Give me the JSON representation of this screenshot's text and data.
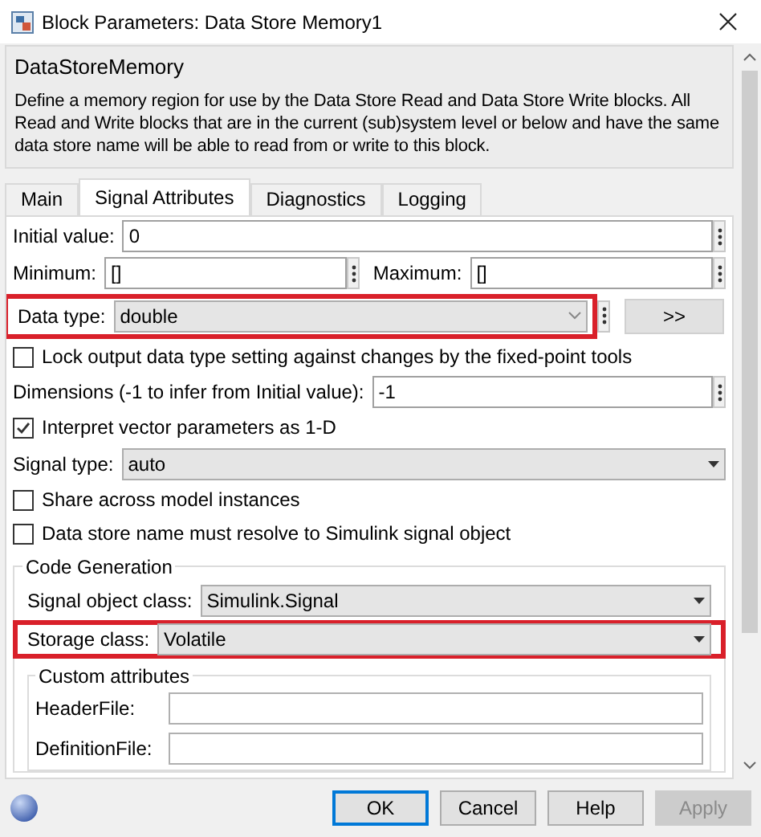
{
  "window": {
    "title": "Block Parameters: Data Store Memory1"
  },
  "description": {
    "heading": "DataStoreMemory",
    "text": "Define a memory region for use by the Data Store Read and Data Store Write blocks. All Read and Write blocks that are in the current (sub)system level or below and have the same data store name will be able to read from or write to this block."
  },
  "tabs": [
    {
      "label": "Main",
      "selected": false
    },
    {
      "label": "Signal Attributes",
      "selected": true
    },
    {
      "label": "Diagnostics",
      "selected": false
    },
    {
      "label": "Logging",
      "selected": false
    }
  ],
  "fields": [
    {
      "kind": "edit",
      "label": "Initial value:",
      "value": "0"
    },
    {
      "kind": "pair",
      "label": "Minimum:",
      "value": "[]",
      "label2": "Maximum:",
      "value2": "[]"
    },
    {
      "kind": "datatype",
      "label": "Data type:",
      "value": "double",
      "button": ">>",
      "highlighted": true
    },
    {
      "kind": "checkbox",
      "label": "Lock output data type setting against changes by the fixed-point tools",
      "checked": false
    },
    {
      "kind": "edit",
      "label": "Dimensions (-1 to infer from Initial value):",
      "value": "-1"
    },
    {
      "kind": "checkbox",
      "label": "Interpret vector parameters as 1-D",
      "checked": true
    },
    {
      "kind": "dropdown",
      "label": "Signal type:",
      "value": "auto"
    },
    {
      "kind": "checkbox",
      "label": "Share across model instances",
      "checked": false
    },
    {
      "kind": "checkbox",
      "label": "Data store name must resolve to Simulink signal object",
      "checked": false
    }
  ],
  "code_generation": {
    "title": "Code Generation",
    "fields": [
      {
        "kind": "dropdown",
        "label": "Signal object class:",
        "value": "Simulink.Signal"
      },
      {
        "kind": "dropdown",
        "label": "Storage class:",
        "value": "Volatile",
        "highlighted": true
      }
    ],
    "custom_attributes": {
      "title": "Custom attributes",
      "fields": [
        {
          "label": "HeaderFile:"
        },
        {
          "label": "DefinitionFile:"
        }
      ]
    }
  },
  "buttons": [
    {
      "label": "OK",
      "disabled": false,
      "default": true
    },
    {
      "label": "Cancel",
      "disabled": false,
      "default": false
    },
    {
      "label": "Help",
      "disabled": false,
      "default": false
    },
    {
      "label": "Apply",
      "disabled": true,
      "default": false
    }
  ]
}
